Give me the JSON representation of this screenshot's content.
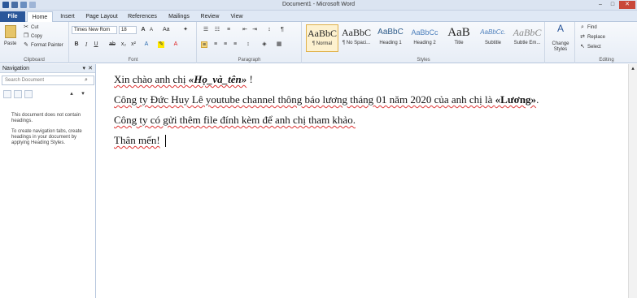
{
  "window": {
    "title": "Document1 - Microsoft Word",
    "controls": {
      "minimize": "–",
      "maximize": "□",
      "close": "✕"
    }
  },
  "tabs": [
    "File",
    "Home",
    "Insert",
    "Page Layout",
    "References",
    "Mailings",
    "Review",
    "View"
  ],
  "active_tab": "Home",
  "clipboard": {
    "paste": "Paste",
    "cut": "Cut",
    "copy": "Copy",
    "format_painter": "Format Painter",
    "label": "Clipboard"
  },
  "font": {
    "name": "Times New Rom",
    "size": "18",
    "label": "Font"
  },
  "paragraph": {
    "label": "Paragraph"
  },
  "styles": {
    "label": "Styles",
    "items": [
      {
        "preview": "AaBbC",
        "name": "¶ Normal"
      },
      {
        "preview": "AaBbC",
        "name": "¶ No Spaci..."
      },
      {
        "preview": "AaBbC",
        "name": "Heading 1"
      },
      {
        "preview": "AaBbCc",
        "name": "Heading 2"
      },
      {
        "preview": "AaB",
        "name": "Title"
      },
      {
        "preview": "AaBbCc.",
        "name": "Subtitle"
      },
      {
        "preview": "AaBbC",
        "name": "Subtle Em..."
      }
    ],
    "change_styles": "Change Styles"
  },
  "editing": {
    "find": "Find",
    "replace": "Replace",
    "select": "Select",
    "label": "Editing"
  },
  "navigation": {
    "title": "Navigation",
    "search_placeholder": "Search Document",
    "message1": "This document does not contain headings.",
    "message2": "To create navigation tabs, create headings in your document by applying Heading Styles."
  },
  "document": {
    "p1_a": "Xin chào anh chị ",
    "p1_field": "«Họ_và_tên»",
    "p1_b": " !",
    "p2_a": "Công ty Đức Huy Lê youtube channel thông báo lương tháng 01 năm 2020 của anh chị là ",
    "p2_field": "«Lương»",
    "p2_b": ".",
    "p3": "Công ty có gửi thêm file đính kèm để anh chị tham khảo.",
    "p4": "Thân mến!"
  }
}
